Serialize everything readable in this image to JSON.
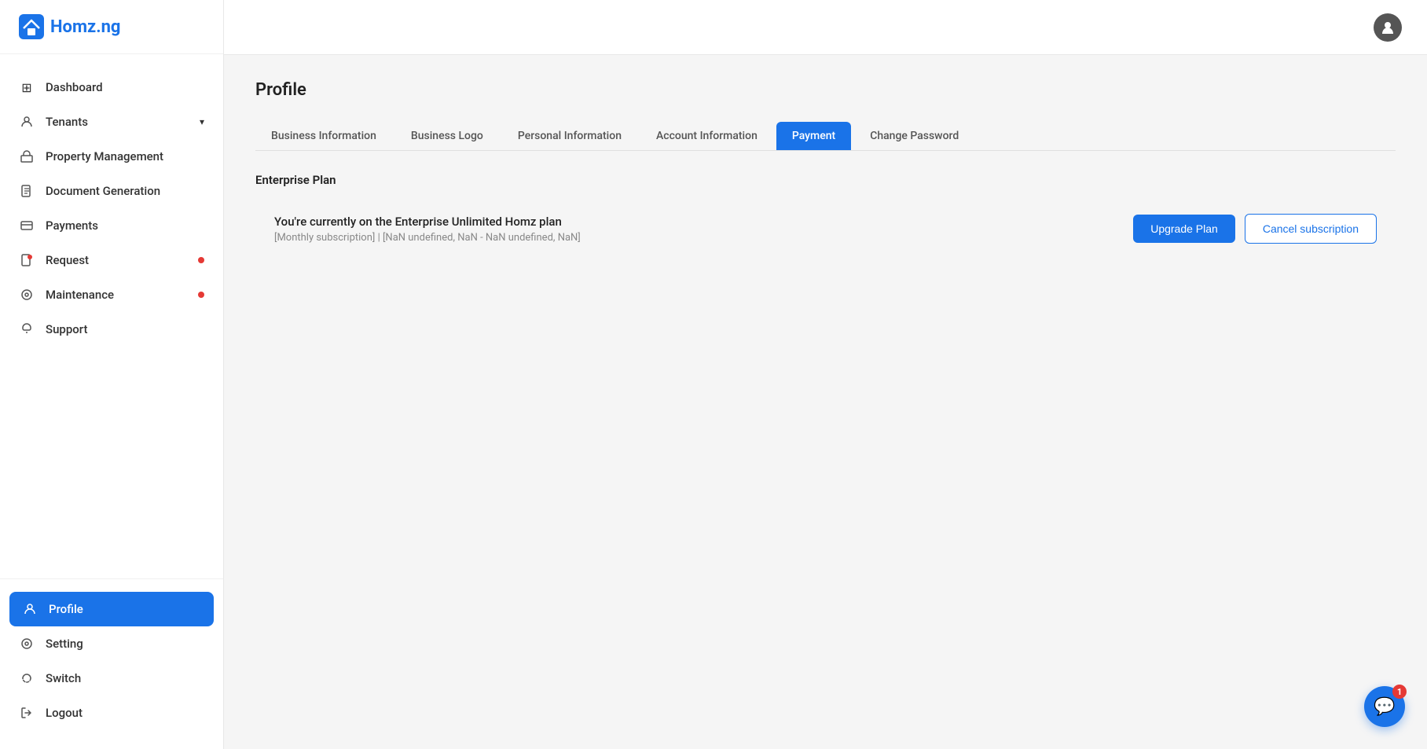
{
  "brand": {
    "name": "Homz.ng",
    "logo_alt": "Homz logo"
  },
  "sidebar": {
    "items": [
      {
        "id": "dashboard",
        "label": "Dashboard",
        "icon": "⊞",
        "active": false,
        "badge": false
      },
      {
        "id": "tenants",
        "label": "Tenants",
        "icon": "👤",
        "active": false,
        "badge": false,
        "has_chevron": true
      },
      {
        "id": "property-management",
        "label": "Property Management",
        "icon": "🏷",
        "active": false,
        "badge": false
      },
      {
        "id": "document-generation",
        "label": "Document Generation",
        "icon": "📄",
        "active": false,
        "badge": false
      },
      {
        "id": "payments",
        "label": "Payments",
        "icon": "💳",
        "active": false,
        "badge": false
      },
      {
        "id": "request",
        "label": "Request",
        "icon": "📋",
        "active": false,
        "badge": true
      },
      {
        "id": "maintenance",
        "label": "Maintenance",
        "icon": "⚙",
        "active": false,
        "badge": true
      },
      {
        "id": "support",
        "label": "Support",
        "icon": "📞",
        "active": false,
        "badge": false
      }
    ],
    "bottom_items": [
      {
        "id": "profile",
        "label": "Profile",
        "icon": "👤",
        "active": true,
        "badge": false
      },
      {
        "id": "setting",
        "label": "Setting",
        "icon": "⚙",
        "active": false,
        "badge": false
      },
      {
        "id": "switch",
        "label": "Switch",
        "icon": "🔄",
        "active": false,
        "badge": false
      },
      {
        "id": "logout",
        "label": "Logout",
        "icon": "🚪",
        "active": false,
        "badge": false
      }
    ]
  },
  "page": {
    "title": "Profile"
  },
  "tabs": [
    {
      "id": "business-information",
      "label": "Business Information",
      "active": false
    },
    {
      "id": "business-logo",
      "label": "Business Logo",
      "active": false
    },
    {
      "id": "personal-information",
      "label": "Personal Information",
      "active": false
    },
    {
      "id": "account-information",
      "label": "Account Information",
      "active": false
    },
    {
      "id": "payment",
      "label": "Payment",
      "active": true
    },
    {
      "id": "change-password",
      "label": "Change Password",
      "active": false
    }
  ],
  "payment": {
    "section_title": "Enterprise Plan",
    "plan_name": "You're currently on the Enterprise Unlimited Homz plan",
    "plan_details": "[Monthly subscription] | [NaN undefined, NaN - NaN undefined, NaN]",
    "upgrade_label": "Upgrade Plan",
    "cancel_label": "Cancel subscription"
  },
  "chat": {
    "badge_count": "1"
  }
}
